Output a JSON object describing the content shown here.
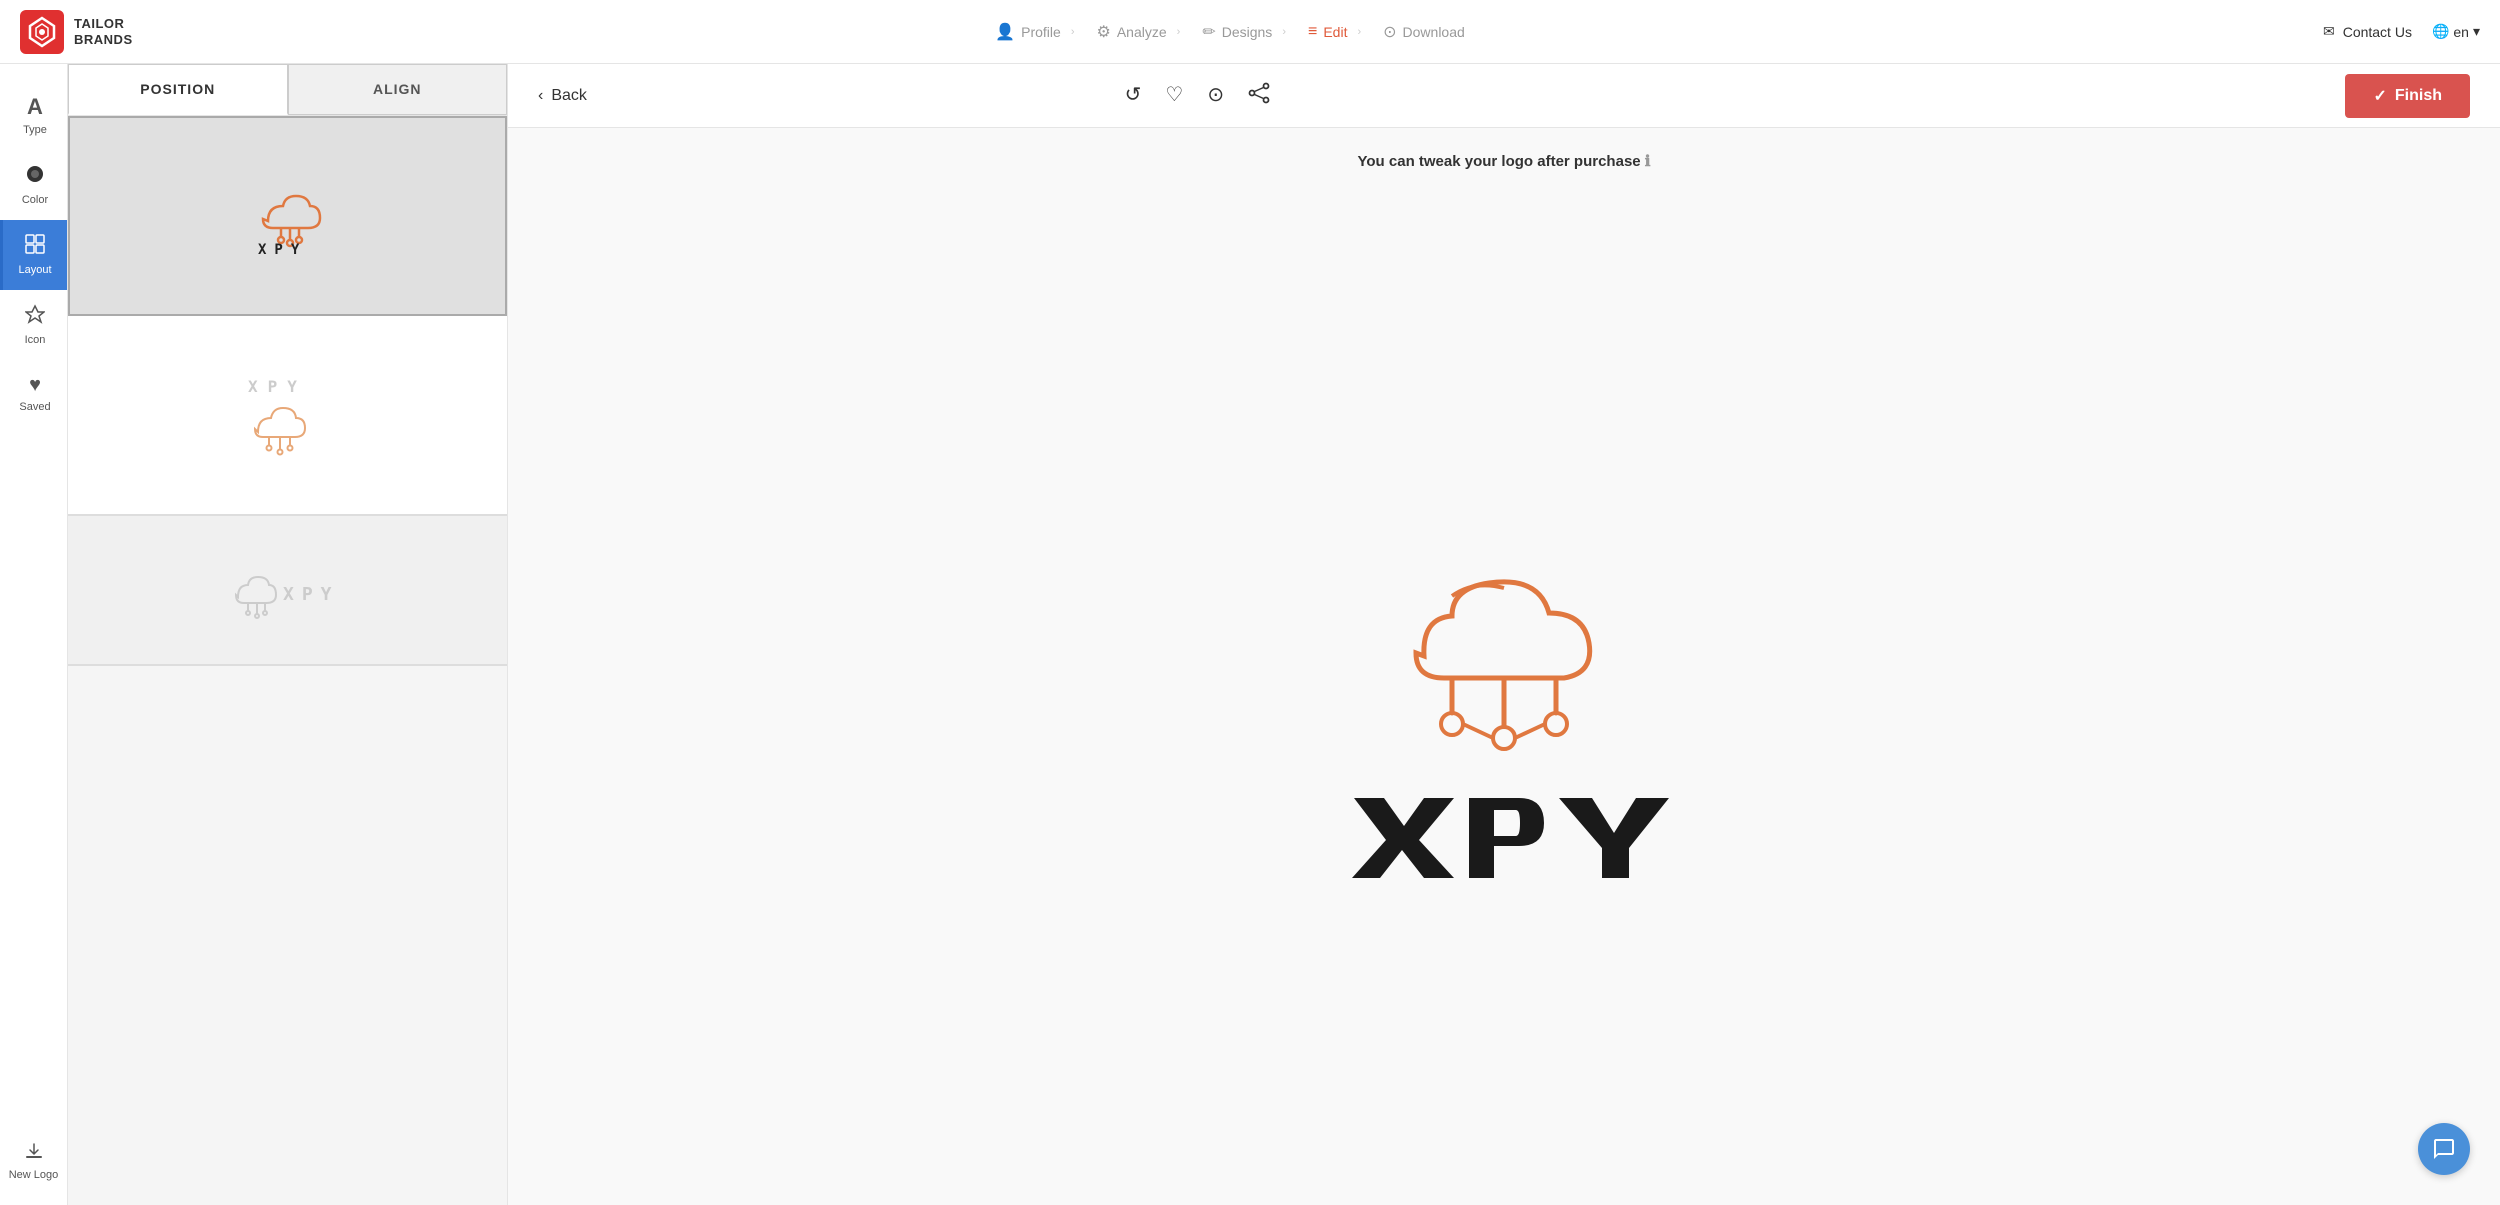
{
  "brand": {
    "name_line1": "TAILOR",
    "name_line2": "BRANDS"
  },
  "nav": {
    "steps": [
      {
        "id": "profile",
        "label": "Profile",
        "icon": "👤",
        "active": false
      },
      {
        "id": "analyze",
        "label": "Analyze",
        "icon": "⚙",
        "active": false
      },
      {
        "id": "designs",
        "label": "Designs",
        "icon": "✏",
        "active": false
      },
      {
        "id": "edit",
        "label": "Edit",
        "icon": "≡",
        "active": true
      },
      {
        "id": "download",
        "label": "Download",
        "icon": "⊙",
        "active": false
      }
    ],
    "contact_label": "Contact Us",
    "lang_label": "en"
  },
  "sidebar": {
    "items": [
      {
        "id": "type",
        "label": "Type",
        "icon": "A"
      },
      {
        "id": "color",
        "label": "Color",
        "icon": "◉"
      },
      {
        "id": "layout",
        "label": "Layout",
        "icon": "⊞",
        "active": true
      },
      {
        "id": "icon",
        "label": "Icon",
        "icon": "◇"
      },
      {
        "id": "saved",
        "label": "Saved",
        "icon": "♥"
      }
    ],
    "new_logo_label": "New Logo",
    "new_logo_icon": "↑"
  },
  "panel": {
    "tab_position": "POSITION",
    "tab_align": "ALIGN"
  },
  "toolbar": {
    "back_label": "Back",
    "finish_label": "Finish",
    "undo_icon": "↺",
    "heart_icon": "♡",
    "clock_icon": "⊙",
    "share_icon": "⬡"
  },
  "canvas": {
    "notice": "You can tweak your logo after purchase",
    "info_icon": "ℹ"
  },
  "colors": {
    "accent_orange": "#e07840",
    "accent_red": "#d9534f",
    "accent_blue": "#3b7dd8",
    "brand_red": "#e03030"
  }
}
